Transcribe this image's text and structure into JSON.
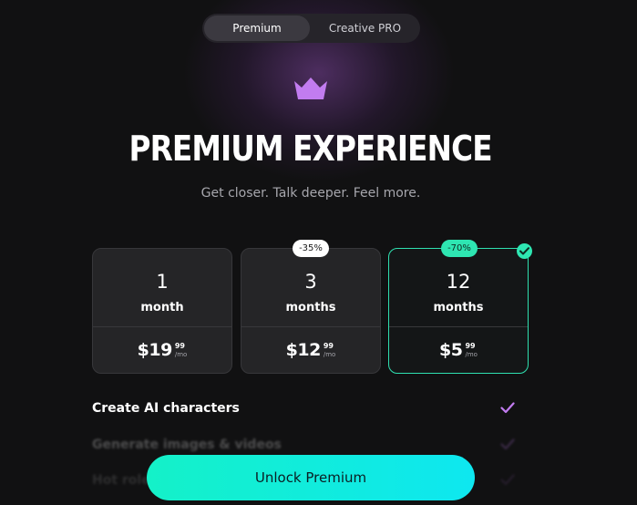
{
  "toggle": {
    "options": [
      {
        "label": "Premium",
        "active": true
      },
      {
        "label": "Creative PRO",
        "active": false
      }
    ]
  },
  "hero": {
    "icon": "crown-icon",
    "title": "PREMIUM EXPERIENCE",
    "subtitle": "Get closer. Talk deeper. Feel more."
  },
  "plans": [
    {
      "quantity": "1",
      "unit": "month",
      "price_main": "$19",
      "price_cents": "99",
      "price_period": "/mo",
      "badge": "",
      "selected": false
    },
    {
      "quantity": "3",
      "unit": "months",
      "price_main": "$12",
      "price_cents": "99",
      "price_period": "/mo",
      "badge": "-35%",
      "selected": false
    },
    {
      "quantity": "12",
      "unit": "months",
      "price_main": "$5",
      "price_cents": "99",
      "price_period": "/mo",
      "badge": "-70%",
      "selected": true
    }
  ],
  "features": [
    {
      "label": "Create AI characters",
      "icon": "check-icon"
    },
    {
      "label": "Generate images & videos",
      "icon": "check-icon"
    },
    {
      "label": "Hot roleplay",
      "icon": "check-icon"
    }
  ],
  "cta": {
    "label": "Unlock Premium"
  },
  "colors": {
    "background": "#111112",
    "accent_green": "#2ee6b2",
    "accent_purple": "#c27cf0",
    "cta_gradient_start": "#14f1c8",
    "cta_gradient_end": "#0ee7f0"
  }
}
